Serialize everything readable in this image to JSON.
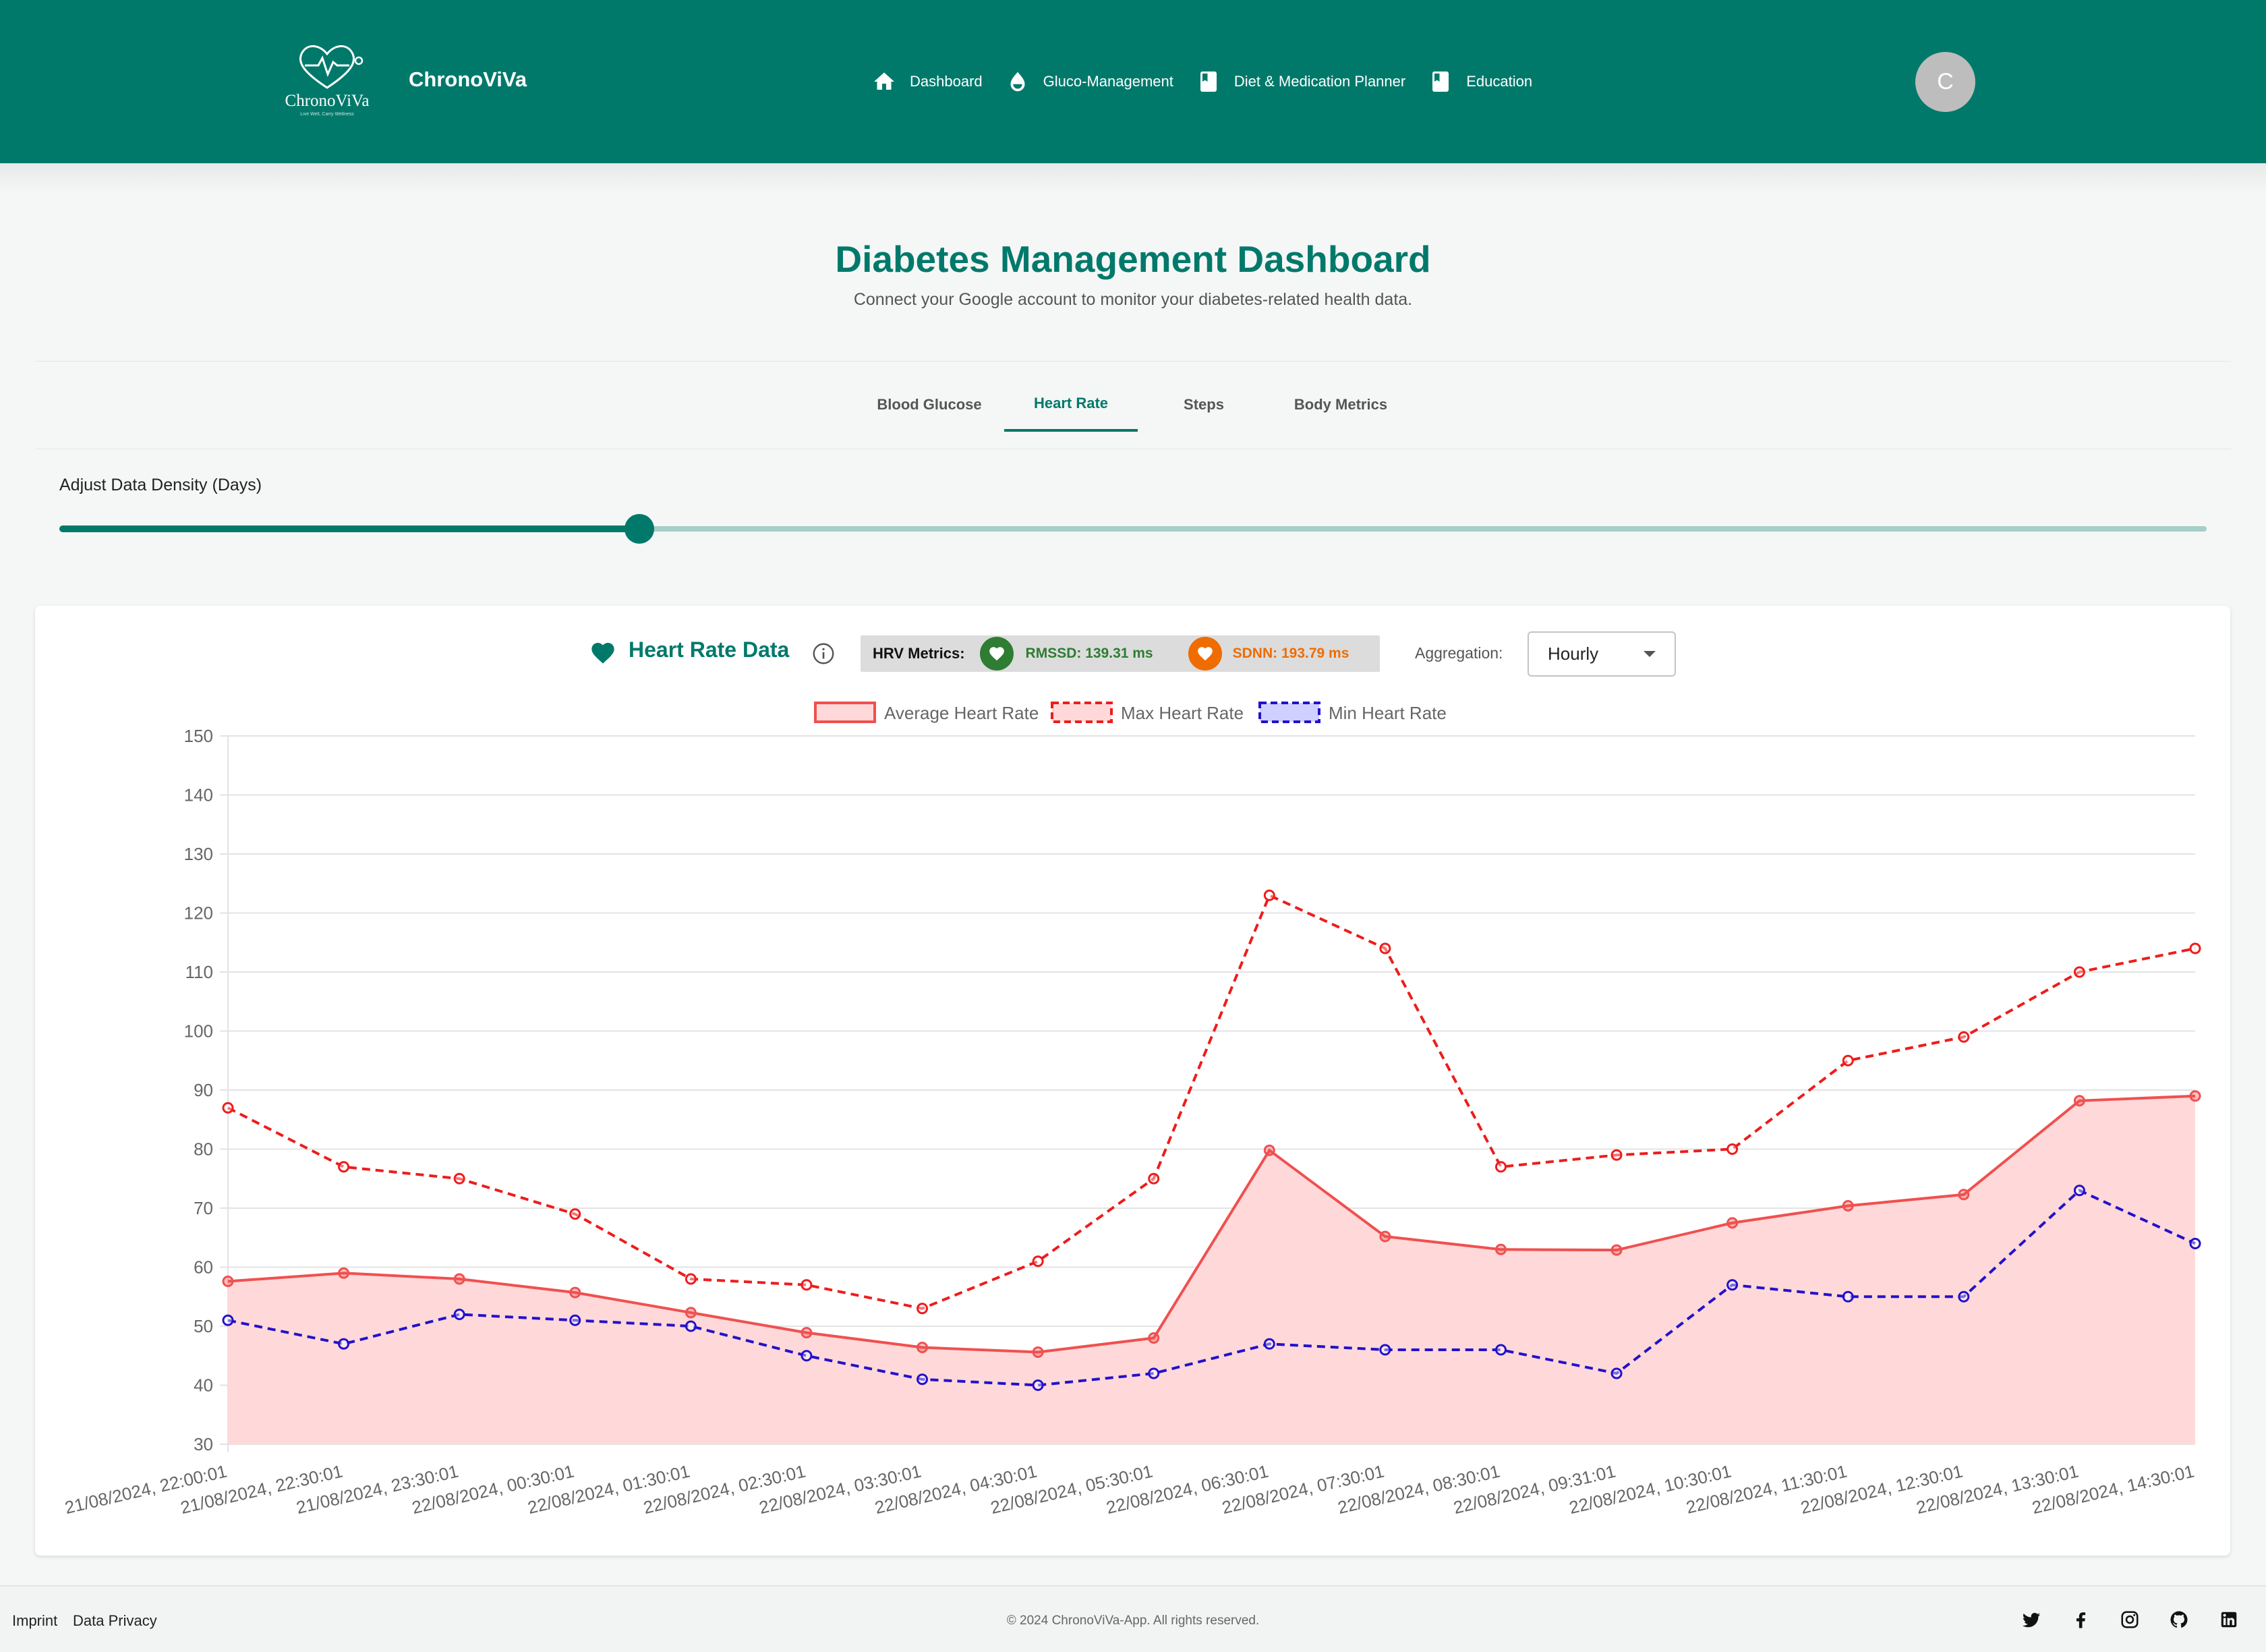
{
  "header": {
    "logo_text": "ChronoViVa",
    "logo_tagline": "Live Well, Carry Wellness",
    "brand": "ChronoViVa",
    "nav": [
      {
        "label": "Dashboard",
        "icon": "home-icon"
      },
      {
        "label": "Gluco-Management",
        "icon": "drop-icon"
      },
      {
        "label": "Diet & Medication Planner",
        "icon": "book-icon"
      },
      {
        "label": "Education",
        "icon": "book-icon"
      }
    ],
    "avatar_initial": "C",
    "color": "#00796b"
  },
  "page": {
    "title": "Diabetes Management Dashboard",
    "subtitle": "Connect your Google account to monitor your diabetes-related health data."
  },
  "tabs": [
    {
      "label": "Blood Glucose",
      "active": false
    },
    {
      "label": "Heart Rate",
      "active": true
    },
    {
      "label": "Steps",
      "active": false
    },
    {
      "label": "Body Metrics",
      "active": false
    }
  ],
  "slider": {
    "label": "Adjust Data Density (Days)",
    "fraction": 0.27
  },
  "card": {
    "title": "Heart Rate Data",
    "hrv_label": "HRV Metrics:",
    "rmssd": "RMSSD: 139.31 ms",
    "sdnn": "SDNN: 193.79 ms",
    "aggregation_label": "Aggregation:",
    "aggregation_value": "Hourly"
  },
  "chart_data": {
    "type": "line",
    "title": "",
    "xlabel": "",
    "ylabel": "",
    "ylim": [
      30,
      150
    ],
    "yticks": [
      30,
      40,
      50,
      60,
      70,
      80,
      90,
      100,
      110,
      120,
      130,
      140,
      150
    ],
    "grid": true,
    "legend_position": "top-center",
    "x": [
      "21/08/2024, 22:00:01",
      "21/08/2024, 22:30:01",
      "21/08/2024, 23:30:01",
      "22/08/2024, 00:30:01",
      "22/08/2024, 01:30:01",
      "22/08/2024, 02:30:01",
      "22/08/2024, 03:30:01",
      "22/08/2024, 04:30:01",
      "22/08/2024, 05:30:01",
      "22/08/2024, 06:30:01",
      "22/08/2024, 07:30:01",
      "22/08/2024, 08:30:01",
      "22/08/2024, 09:31:01",
      "22/08/2024, 10:30:01",
      "22/08/2024, 11:30:01",
      "22/08/2024, 12:30:01",
      "22/08/2024, 13:30:01",
      "22/08/2024, 14:30:01"
    ],
    "series": [
      {
        "name": "Average Heart Rate",
        "color": "#f05050",
        "fill": "#ffd9d9",
        "style": "solid",
        "values": [
          57.6,
          59,
          58,
          55.7,
          52.3,
          48.9,
          46.4,
          45.6,
          48,
          79.8,
          65.2,
          63,
          62.9,
          67.5,
          70.4,
          72.3,
          88.2,
          89
        ]
      },
      {
        "name": "Max Heart Rate",
        "color": "#ee1c1c",
        "style": "dashed",
        "values": [
          87,
          77,
          75,
          69,
          58,
          57,
          53,
          61,
          75,
          123,
          114,
          77,
          79,
          80,
          95,
          99,
          110,
          114
        ]
      },
      {
        "name": "Min Heart Rate",
        "color": "#2211cc",
        "style": "dashed",
        "values": [
          51,
          47,
          52,
          51,
          50,
          45,
          41,
          40,
          42,
          47,
          46,
          46,
          42,
          57,
          55,
          55,
          73,
          64
        ]
      }
    ]
  },
  "footer": {
    "imprint": "Imprint",
    "privacy": "Data Privacy",
    "copyright": "© 2024 ChronoViVa-App. All rights reserved.",
    "social": [
      "twitter-icon",
      "facebook-icon",
      "instagram-icon",
      "github-icon",
      "linkedin-icon"
    ]
  }
}
